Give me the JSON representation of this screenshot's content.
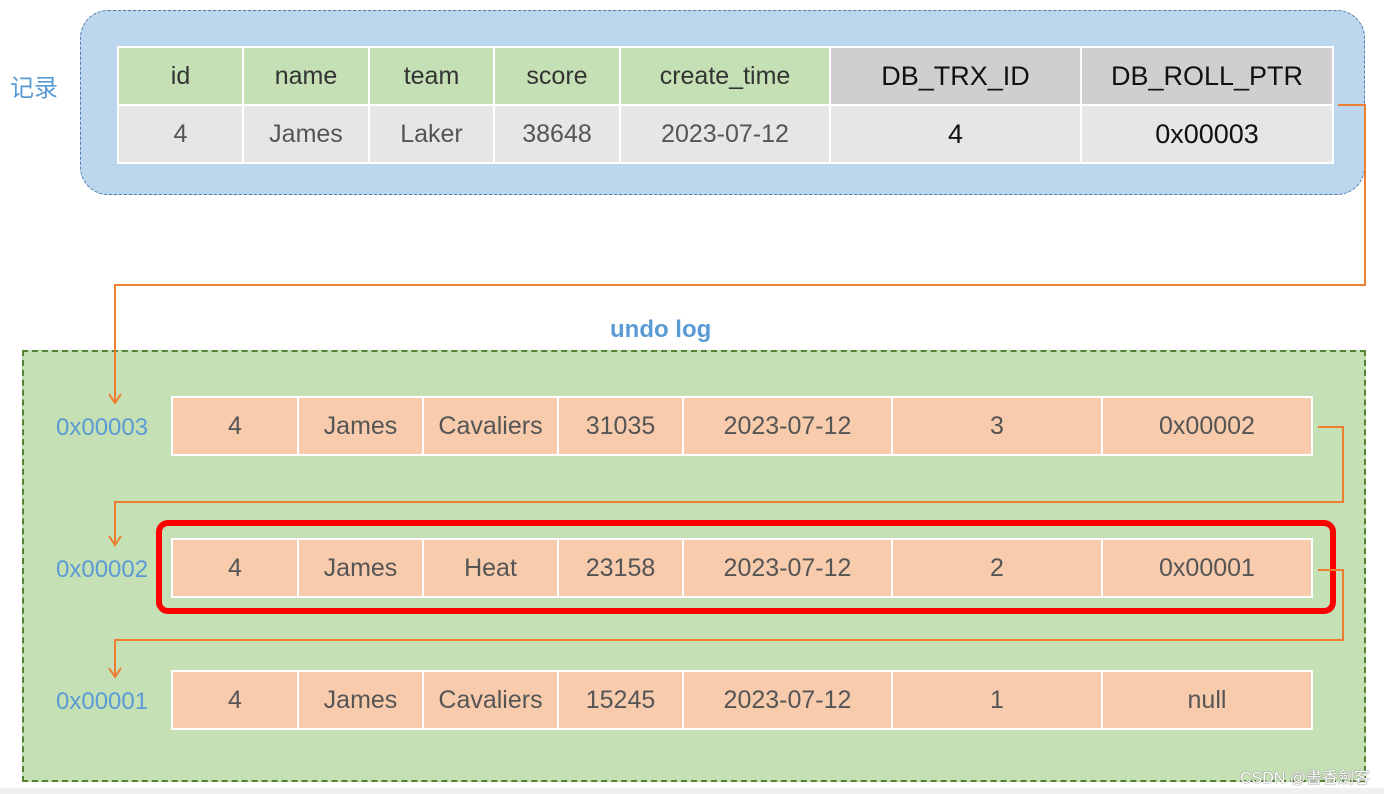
{
  "record": {
    "label": "记录",
    "headers": [
      "id",
      "name",
      "team",
      "score",
      "create_time",
      "DB_TRX_ID",
      "DB_ROLL_PTR"
    ],
    "values": [
      "4",
      "James",
      "Laker",
      "38648",
      "2023-07-12",
      "4",
      "0x00003"
    ]
  },
  "undo_log": {
    "title": "undo log",
    "entries": [
      {
        "address": "0x00003",
        "values": [
          "4",
          "James",
          "Cavaliers",
          "31035",
          "2023-07-12",
          "3",
          "0x00002"
        ]
      },
      {
        "address": "0x00002",
        "values": [
          "4",
          "James",
          "Heat",
          "23158",
          "2023-07-12",
          "2",
          "0x00001"
        ],
        "highlighted": true
      },
      {
        "address": "0x00001",
        "values": [
          "4",
          "James",
          "Cavaliers",
          "15245",
          "2023-07-12",
          "1",
          "null"
        ]
      }
    ]
  },
  "colors": {
    "record_bg": "#bcd6ee",
    "header_green": "#c5e0b4",
    "header_gray": "#d0cece",
    "undo_bg": "#c5e0b4",
    "undo_row": "#f8cbad",
    "arrow": "#ed7d31",
    "highlight": "#ff0000",
    "label_blue": "#5b9bd5"
  },
  "watermark": "CSDN @書香劍客"
}
